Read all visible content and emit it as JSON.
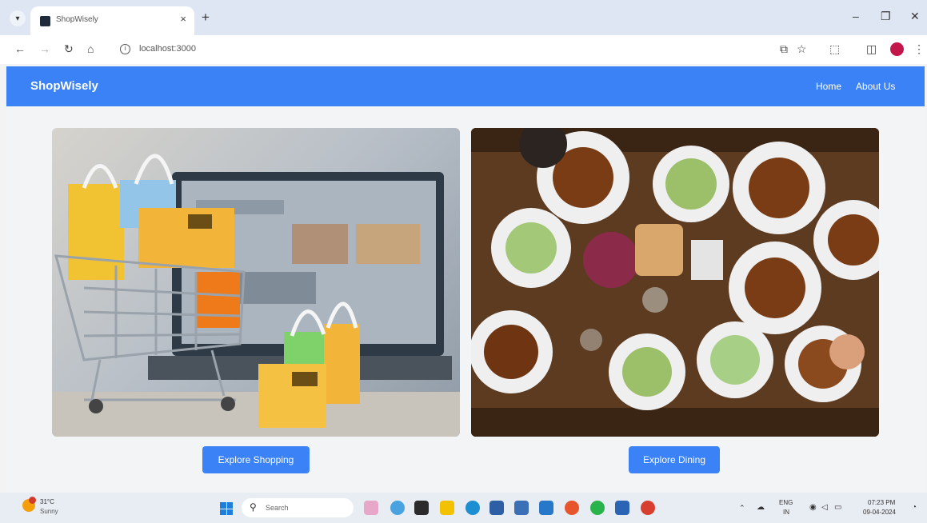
{
  "browser": {
    "tab_title": "ShopWisely",
    "url": "localhost:3000"
  },
  "page": {
    "brand": "ShopWisely",
    "nav": [
      {
        "label": "Home"
      },
      {
        "label": "About Us"
      }
    ],
    "cards": [
      {
        "image": "shopping-cart-with-bags",
        "button": "Explore Shopping"
      },
      {
        "image": "dining-table-top-view",
        "button": "Explore Dining"
      }
    ]
  },
  "taskbar": {
    "weather_temp": "31°C",
    "weather_condition": "Sunny",
    "search_placeholder": "Search",
    "language": "ENG",
    "region": "IN",
    "time": "07:23 PM",
    "date": "09-04-2024"
  },
  "colors": {
    "accent": "#3b82f6",
    "page_bg": "#f3f4f6"
  }
}
